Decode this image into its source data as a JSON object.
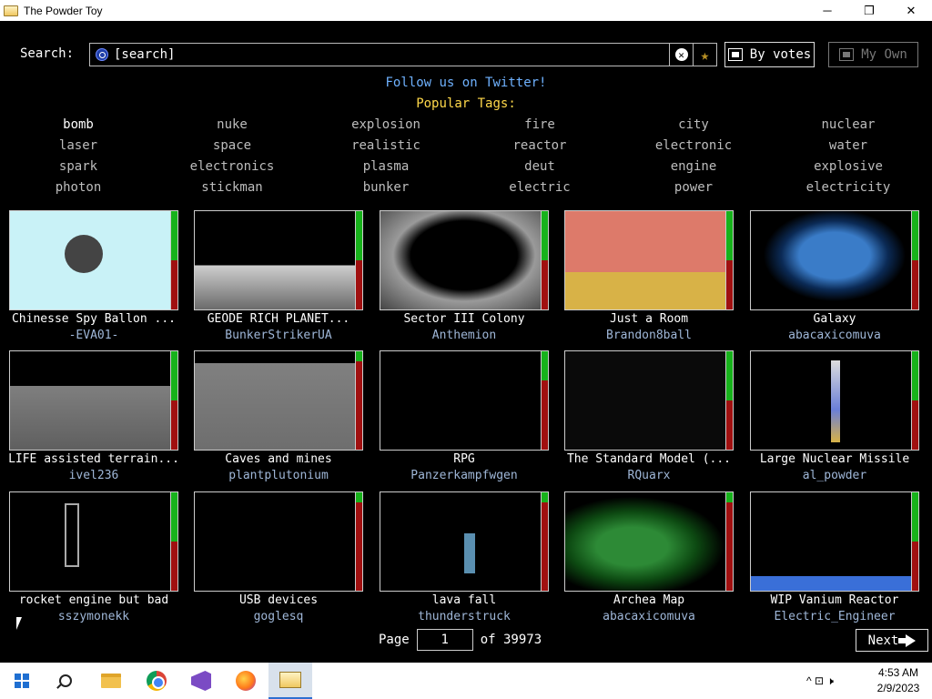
{
  "window": {
    "title": "The Powder Toy",
    "minimize": "─",
    "maximize": "❐",
    "close": "✕"
  },
  "search": {
    "label": "Search:",
    "value": "[search]",
    "clear_glyph": "✕",
    "fav_glyph": "★"
  },
  "sort_button": {
    "label": "By votes",
    "icon": "sort-icon"
  },
  "own_button": {
    "label": "My Own",
    "icon": "folder-icon"
  },
  "twitter_link": "Follow us on Twitter!",
  "popular_heading": "Popular Tags:",
  "tags": [
    [
      "bomb",
      "nuke",
      "explosion",
      "fire",
      "city",
      "nuclear"
    ],
    [
      "laser",
      "space",
      "realistic",
      "reactor",
      "electronic",
      "water"
    ],
    [
      "spark",
      "electronics",
      "plasma",
      "deut",
      "engine",
      "explosive"
    ],
    [
      "photon",
      "stickman",
      "bunker",
      "electric",
      "power",
      "electricity"
    ]
  ],
  "saves": [
    {
      "name": "Chinesse Spy Ballon ...",
      "author": "-EVA01-",
      "up": 0.5
    },
    {
      "name": "GEODE RICH PLANET...",
      "author": "BunkerStrikerUA",
      "up": 0.5
    },
    {
      "name": "Sector III Colony",
      "author": "Anthemion",
      "up": 0.5
    },
    {
      "name": "Just a Room",
      "author": "Brandon8ball",
      "up": 0.5
    },
    {
      "name": "Galaxy",
      "author": "abacaxicomuva",
      "up": 0.5
    },
    {
      "name": "LIFE assisted terrain...",
      "author": "ivel236",
      "up": 0.5
    },
    {
      "name": "Caves and mines",
      "author": "plantplutonium",
      "up": 0.1
    },
    {
      "name": "RPG",
      "author": "Panzerkampfwgen",
      "up": 0.3
    },
    {
      "name": "The Standard Model (...",
      "author": "RQuarx",
      "up": 0.5
    },
    {
      "name": "Large Nuclear Missile",
      "author": "al_powder",
      "up": 0.5
    },
    {
      "name": "rocket engine but bad",
      "author": "sszymonekk",
      "up": 0.5
    },
    {
      "name": "USB devices",
      "author": "goglesq",
      "up": 0.1
    },
    {
      "name": "lava fall",
      "author": "thunderstruck",
      "up": 0.1
    },
    {
      "name": "Archea Map",
      "author": "abacaxicomuva",
      "up": 0.1
    },
    {
      "name": "WIP Vanium Reactor",
      "author": "Electric_Engineer",
      "up": 0.5
    }
  ],
  "pager": {
    "page_label": "Page",
    "current_page": "1",
    "of_label": "of 39973",
    "next_label": "Next"
  },
  "taskbar": {
    "clock_time": "4:53 AM",
    "clock_date": "2/9/2023",
    "tray_glyphs": "^  ⊡  🕨"
  },
  "colors": {
    "twitter": "#6fb2ff",
    "popular": "#ffd84a",
    "author": "#9fb7d8",
    "vote_up": "#17b21b",
    "vote_down": "#a01010"
  }
}
